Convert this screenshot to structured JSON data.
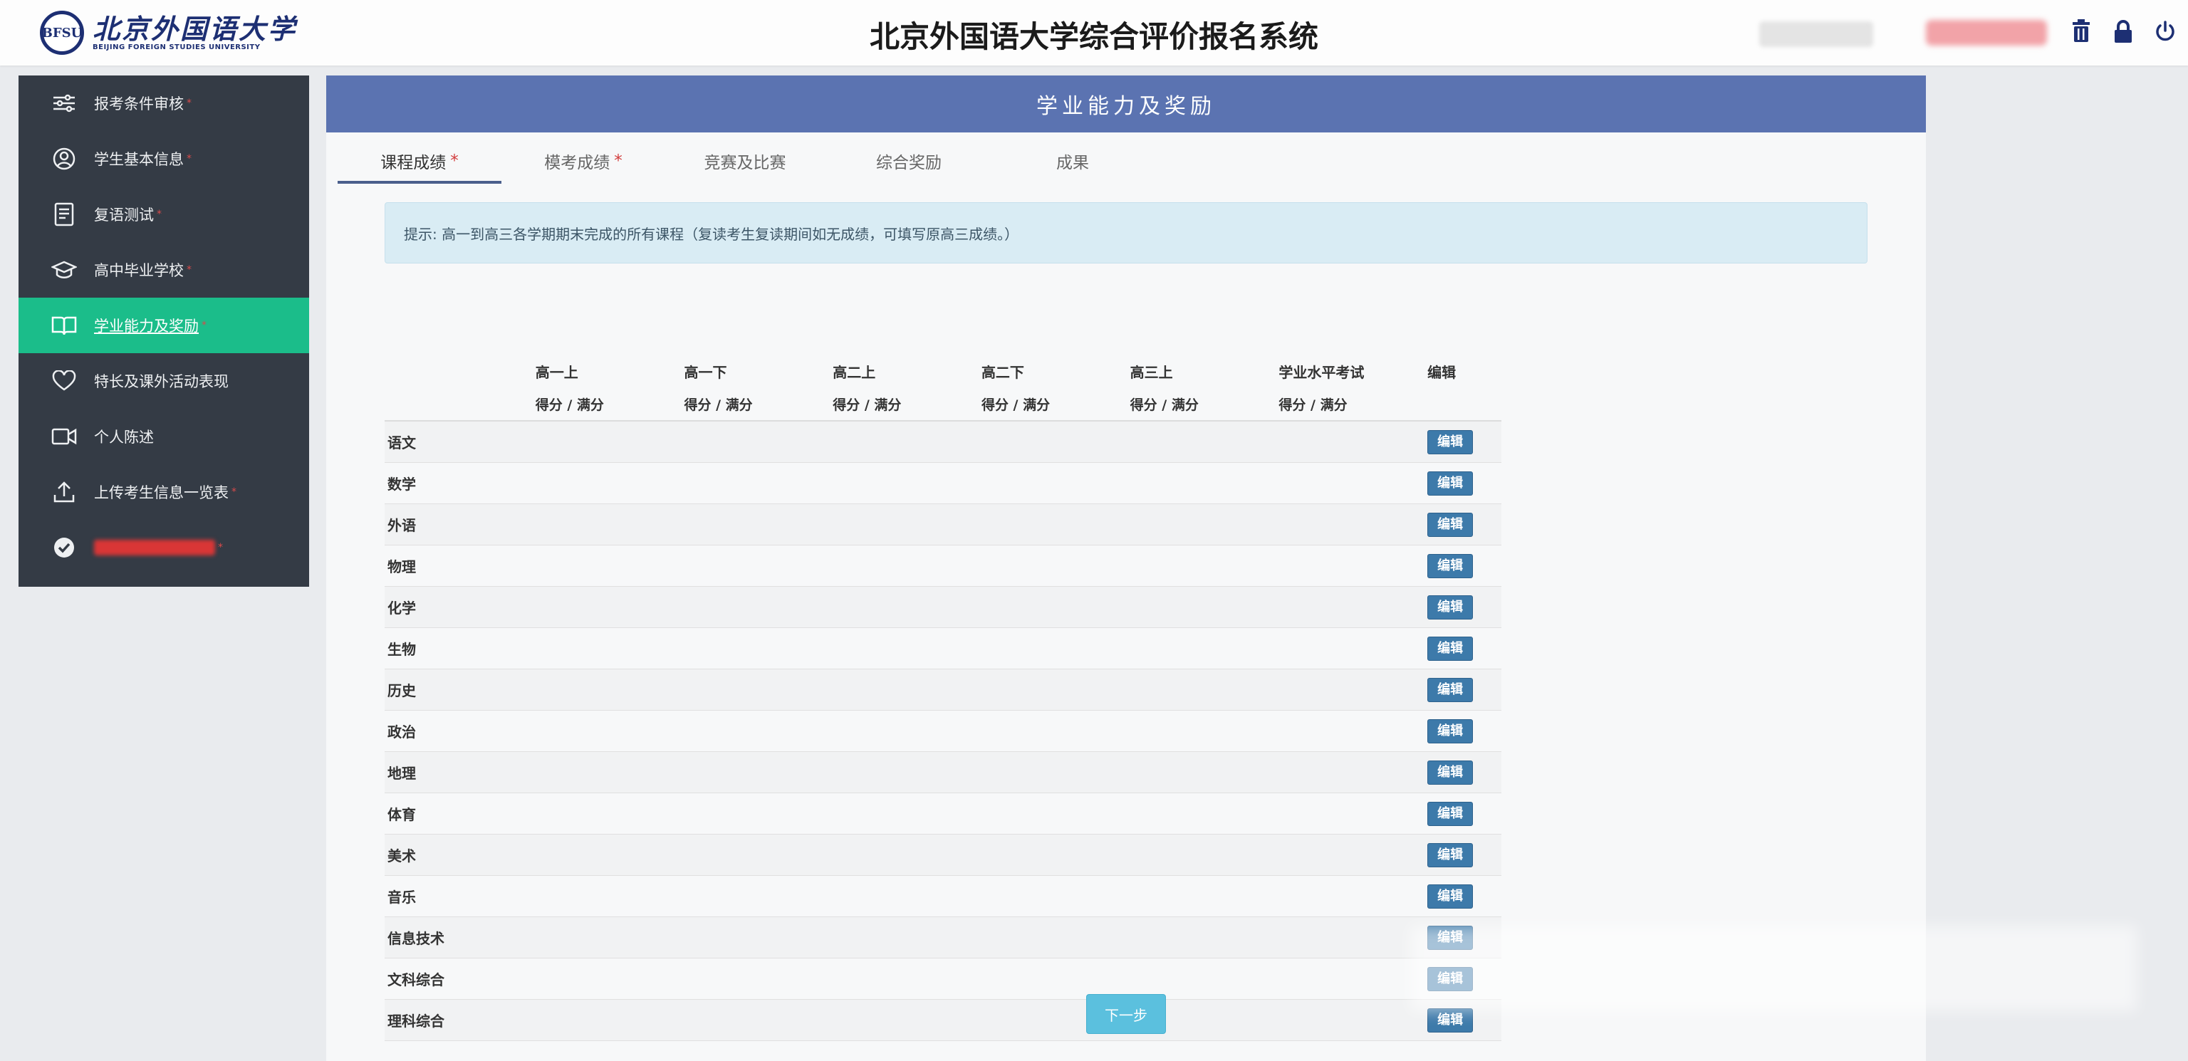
{
  "header": {
    "logo_seal": "BFSU",
    "logo_cn": "北京外国语大学",
    "logo_en": "BEIJING FOREIGN STUDIES UNIVERSITY",
    "title": "北京外国语大学综合评价报名系统"
  },
  "sidebar": {
    "items": [
      {
        "label": "报考条件审核",
        "icon": "sliders-icon",
        "required": "*"
      },
      {
        "label": "学生基本信息",
        "icon": "user-circle-icon",
        "required": "*"
      },
      {
        "label": "复语测试",
        "icon": "document-icon",
        "required": "*"
      },
      {
        "label": "高中毕业学校",
        "icon": "graduation-cap-icon",
        "required": "*"
      },
      {
        "label": "学业能力及奖励",
        "icon": "book-icon",
        "required": "*"
      },
      {
        "label": "特长及课外活动表现",
        "icon": "heart-icon",
        "required": ""
      },
      {
        "label": "个人陈述",
        "icon": "video-icon",
        "required": ""
      },
      {
        "label": "上传考生信息一览表",
        "icon": "upload-icon",
        "required": "*"
      },
      {
        "label": "",
        "icon": "check-circle-icon",
        "required": "*"
      }
    ],
    "active_index": 4
  },
  "panel": {
    "title": "学业能力及奖励",
    "tabs": [
      {
        "label": "课程成绩",
        "star": "*"
      },
      {
        "label": "模考成绩",
        "star": "*"
      },
      {
        "label": "竞赛及比赛",
        "star": ""
      },
      {
        "label": "综合奖励",
        "star": ""
      },
      {
        "label": "成果",
        "star": ""
      }
    ],
    "hint": "提示: 高一到高三各学期期末完成的所有课程（复读考生复读期间如无成绩，可填写原高三成绩。）"
  },
  "table": {
    "columns": [
      "高一上",
      "高一下",
      "高二上",
      "高二下",
      "高三上",
      "学业水平考试"
    ],
    "edit_header": "编辑",
    "score_label": "得分 / 满分",
    "edit_label": "编辑",
    "subjects": [
      "语文",
      "数学",
      "外语",
      "物理",
      "化学",
      "生物",
      "历史",
      "政治",
      "地理",
      "体育",
      "美术",
      "音乐",
      "信息技术",
      "文科综合",
      "理科综合"
    ]
  },
  "next_button": "下一步",
  "colors": {
    "sidebar_bg": "#343b45",
    "active_green": "#1bbd8a",
    "panel_header": "#5b73b1",
    "edit_button": "#3d7aaa",
    "next_button": "#5bc0de"
  }
}
